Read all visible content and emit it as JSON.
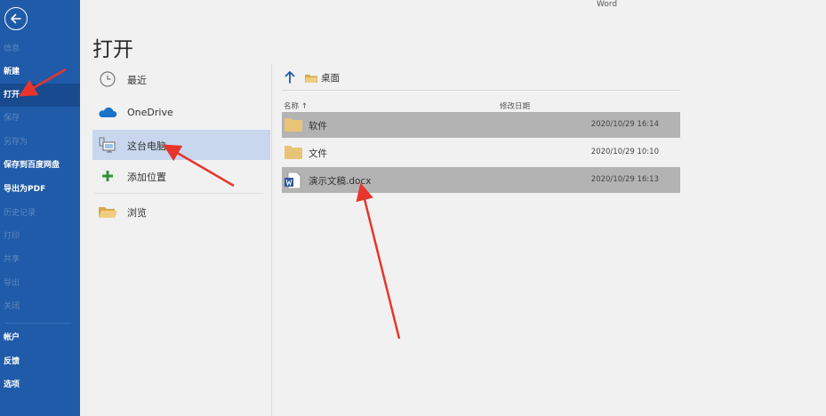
{
  "app": {
    "name": "Word"
  },
  "rail": {
    "items": [
      {
        "label": "信息",
        "dim": true
      },
      {
        "label": "新建",
        "dim": false
      },
      {
        "label": "打开",
        "dim": false,
        "active": true
      },
      {
        "label": "保存",
        "dim": true
      },
      {
        "label": "另存为",
        "dim": true
      },
      {
        "label": "保存到百度网盘",
        "dim": false
      },
      {
        "label": "导出为PDF",
        "dim": false
      },
      {
        "label": "历史记录",
        "dim": true
      },
      {
        "label": "打印",
        "dim": true
      },
      {
        "label": "共享",
        "dim": true
      },
      {
        "label": "导出",
        "dim": true
      },
      {
        "label": "关闭",
        "dim": true
      },
      {
        "label": "帐户",
        "dim": false
      },
      {
        "label": "反馈",
        "dim": false
      },
      {
        "label": "选项",
        "dim": false
      }
    ]
  },
  "page": {
    "title": "打开"
  },
  "locations": [
    {
      "label": "最近",
      "icon": "clock-icon"
    },
    {
      "label": "OneDrive",
      "icon": "cloud-icon"
    },
    {
      "label": "这台电脑",
      "icon": "computer-icon",
      "selected": true
    },
    {
      "label": "添加位置",
      "icon": "plus-icon"
    },
    {
      "label": "浏览",
      "icon": "folder-open-icon"
    }
  ],
  "path": {
    "current": "桌面"
  },
  "columns": {
    "name": "名称 ↑",
    "modified": "修改日期"
  },
  "files": [
    {
      "name": "软件",
      "type": "folder",
      "date": "2020/10/29 16:14",
      "highlighted": true
    },
    {
      "name": "文件",
      "type": "folder",
      "date": "2020/10/29 10:10",
      "highlighted": false
    },
    {
      "name": "演示文稿.docx",
      "type": "word",
      "date": "2020/10/29 16:13",
      "highlighted": true
    }
  ],
  "colors": {
    "rail": "#1f5ba8",
    "rail_active": "#174a8f",
    "selected_location": "#c8d7ee",
    "file_highlight": "#b3b3b3",
    "annotation_arrow": "#e8352b",
    "folder": "#e8c477",
    "onedrive": "#1a73c9"
  }
}
